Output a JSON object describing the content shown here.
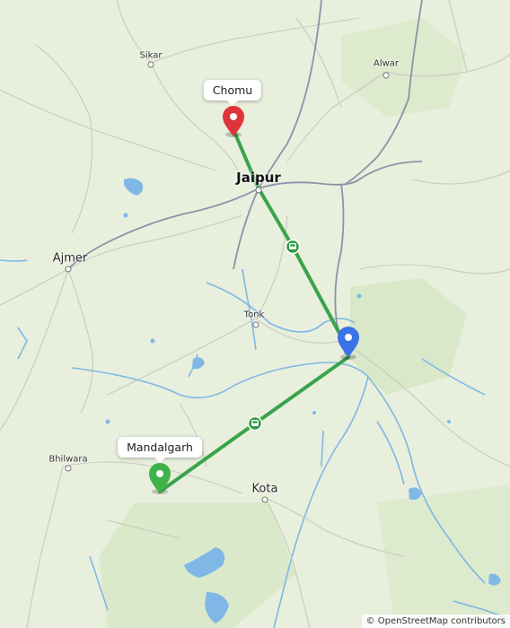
{
  "map": {
    "cities": {
      "sikar": "Sikar",
      "alwar": "Alwar",
      "jaipur": "Jaipur",
      "ajmer": "Ajmer",
      "tonk": "Tonk",
      "bhilwara": "Bhilwara",
      "kota": "Kota"
    },
    "markers": {
      "chomu": {
        "label": "Chomu",
        "color": "#e0343b",
        "icon": "map-pin-icon"
      },
      "mandalgarh": {
        "label": "Mandalgarh",
        "color": "#3fb24a",
        "icon": "map-pin-icon"
      },
      "destination": {
        "color": "#3a72e8",
        "icon": "map-pin-icon"
      }
    },
    "routes": {
      "color": "#2fa24a",
      "transport_icon": "bus-icon"
    },
    "attribution": "© OpenStreetMap contributors"
  }
}
